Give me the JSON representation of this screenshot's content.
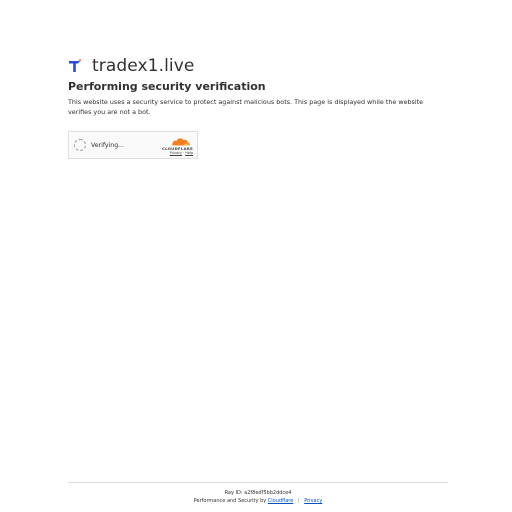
{
  "site": {
    "name": "tradex1.live",
    "logo_icon": "tradex-logo-icon",
    "logo_color": "#2a4bd7",
    "logo_accent": "#f05a24"
  },
  "main": {
    "title": "Performing security verification",
    "description": "This website uses a security service to protect against malicious bots. This page is displayed while the website verifies you are not a bot."
  },
  "widget": {
    "status_text": "Verifying...",
    "brand_word": "CLOUDFLARE",
    "privacy_link": "Privacy",
    "separator": "·",
    "help_link": "Help",
    "brand_orange": "#f38020"
  },
  "footer": {
    "ray_label": "Ray ID:",
    "ray_id": "a2f8edf5bb2ddce4",
    "perf_prefix": "Performance and Security by",
    "perf_link": "Cloudflare",
    "separator": "|",
    "privacy_link": "Privacy",
    "link_color": "#0051c3"
  }
}
